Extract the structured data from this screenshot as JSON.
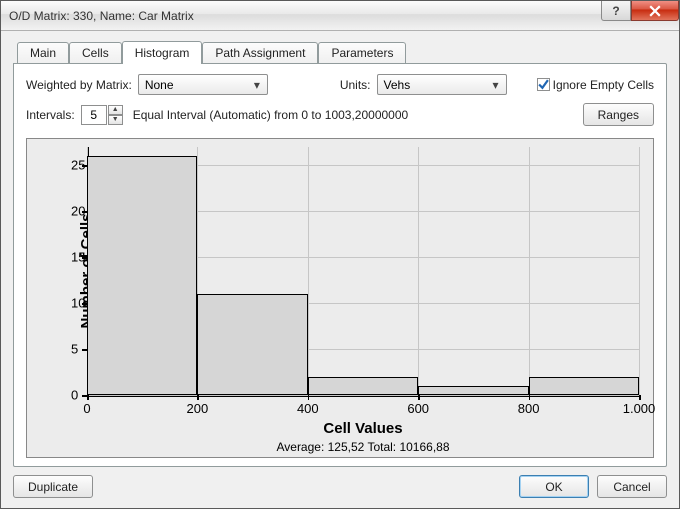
{
  "window": {
    "title": "O/D Matrix: 330, Name: Car Matrix"
  },
  "tabs": {
    "items": [
      {
        "label": "Main"
      },
      {
        "label": "Cells"
      },
      {
        "label": "Histogram"
      },
      {
        "label": "Path Assignment"
      },
      {
        "label": "Parameters"
      }
    ],
    "active_index": 2
  },
  "controls": {
    "weighted_label": "Weighted by Matrix:",
    "weighted_value": "None",
    "units_label": "Units:",
    "units_value": "Vehs",
    "ignore_label": "Ignore Empty Cells",
    "ignore_checked": true,
    "intervals_label": "Intervals:",
    "intervals_value": "5",
    "intervals_desc": "Equal Interval (Automatic) from 0 to 1003,20000000",
    "ranges_button": "Ranges"
  },
  "chart_data": {
    "type": "bar",
    "title": "",
    "xlabel": "Cell Values",
    "ylabel": "Number of Cells",
    "x_edges": [
      0,
      200,
      400,
      600,
      800,
      1000
    ],
    "x_tick_labels": [
      "0",
      "200",
      "400",
      "600",
      "800",
      "1.000"
    ],
    "y_ticks": [
      0,
      5,
      10,
      15,
      20,
      25
    ],
    "ylim": [
      0,
      27
    ],
    "values": [
      26,
      11,
      2,
      1,
      2
    ],
    "stats_text": "Average: 125,52  Total: 10166,88"
  },
  "footer": {
    "duplicate": "Duplicate",
    "ok": "OK",
    "cancel": "Cancel"
  }
}
